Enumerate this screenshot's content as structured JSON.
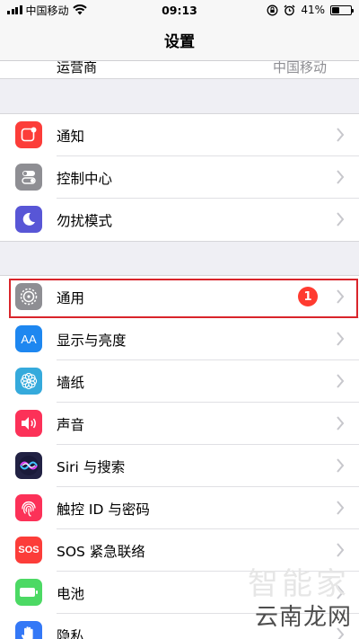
{
  "status_bar": {
    "carrier": "中国移动",
    "time": "09:13",
    "battery_percent": "41%",
    "battery_level": 0.41
  },
  "navbar": {
    "title": "设置"
  },
  "partial_row": {
    "label": "运营商",
    "value": "中国移动"
  },
  "groups": [
    {
      "items": [
        {
          "name": "notifications",
          "label": "通知",
          "icon": "notification-icon",
          "color": "#fc3d39"
        },
        {
          "name": "control-center",
          "label": "控制中心",
          "icon": "toggles-icon",
          "color": "#8e8e93"
        },
        {
          "name": "do-not-disturb",
          "label": "勿扰模式",
          "icon": "moon-icon",
          "color": "#5856d6"
        }
      ]
    },
    {
      "items": [
        {
          "name": "general",
          "label": "通用",
          "icon": "gear-icon",
          "color": "#8e8e93",
          "badge": "1"
        },
        {
          "name": "display-brightness",
          "label": "显示与亮度",
          "icon": "text-size-icon",
          "color": "#1e87f0"
        },
        {
          "name": "wallpaper",
          "label": "墙纸",
          "icon": "flower-icon",
          "color": "#35aadc"
        },
        {
          "name": "sounds",
          "label": "声音",
          "icon": "speaker-icon",
          "color": "#fc3158"
        },
        {
          "name": "siri-search",
          "label": "Siri 与搜索",
          "icon": "siri-icon",
          "color": "#222244"
        },
        {
          "name": "touch-id",
          "label": "触控 ID 与密码",
          "icon": "fingerprint-icon",
          "color": "#fc3158"
        },
        {
          "name": "emergency-sos",
          "label": "SOS 紧急联络",
          "icon": "sos-icon",
          "color": "#fc3d39",
          "icon_text": "SOS"
        },
        {
          "name": "battery",
          "label": "电池",
          "icon": "battery-icon",
          "color": "#4cd964"
        },
        {
          "name": "privacy",
          "label": "隐私",
          "icon": "hand-icon",
          "color": "#3478f6"
        }
      ]
    }
  ],
  "watermark": {
    "text": "云南龙网",
    "bg_text": "智能家"
  }
}
